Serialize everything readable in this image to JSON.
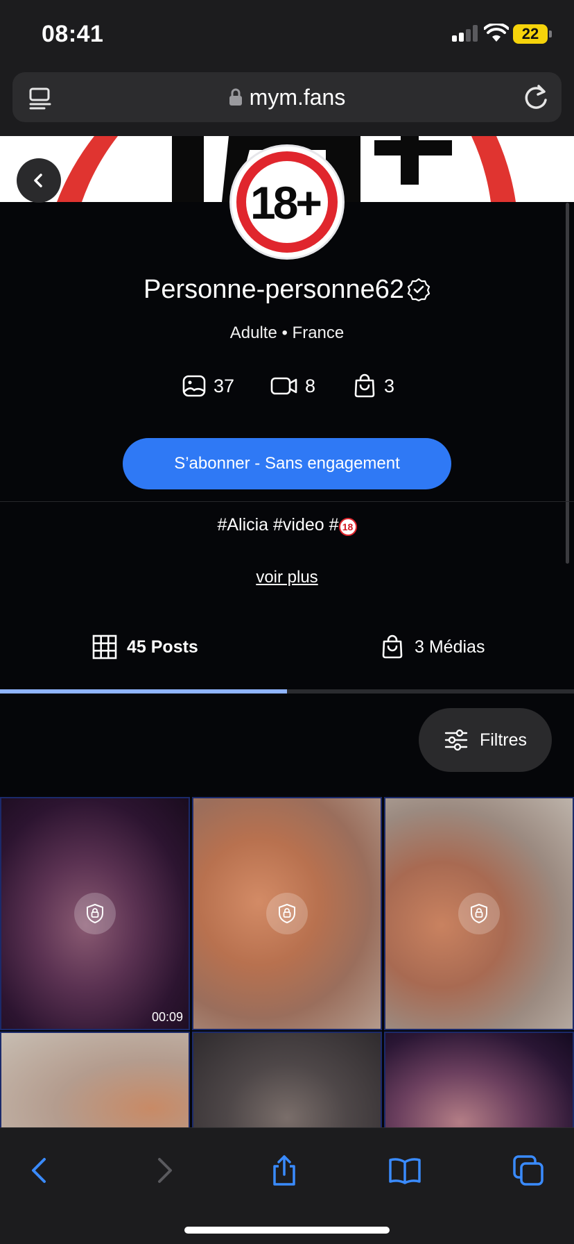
{
  "status_bar": {
    "time": "08:41",
    "battery_level": "22"
  },
  "browser": {
    "url": "mym.fans"
  },
  "profile": {
    "name": "Personne-personne62",
    "meta": "Adulte • France",
    "avatar_text": "18+",
    "stats": {
      "photos": "37",
      "videos": "8",
      "purchases": "3"
    },
    "subscribe_label": "S’abonner - Sans engagement",
    "bio_tags": "#Alicia #video #",
    "bio_badge": "18",
    "see_more_label": "voir plus"
  },
  "tabs": [
    {
      "label": "45 Posts",
      "active": true
    },
    {
      "label": "3 Médias",
      "active": false
    }
  ],
  "filters_label": "Filtres",
  "grid": {
    "items": [
      {
        "locked": true,
        "duration": "00:09"
      },
      {
        "locked": true,
        "duration": ""
      },
      {
        "locked": true,
        "duration": ""
      },
      {
        "locked": false,
        "duration": ""
      },
      {
        "locked": false,
        "duration": ""
      },
      {
        "locked": false,
        "duration": ""
      }
    ]
  },
  "colors": {
    "accent": "#2f79f5",
    "tab_indicator": "#8fb4ff",
    "background": "#050609",
    "badge_red": "#e0262d",
    "battery": "#f5d30b"
  },
  "icons": {
    "photos": "image-icon",
    "videos": "video-camera-icon",
    "purchases": "shopping-bag-icon",
    "posts_tab": "grid-icon",
    "medias_tab": "shopping-bag-icon",
    "filters": "sliders-icon",
    "locked_item": "shield-lock-icon"
  }
}
